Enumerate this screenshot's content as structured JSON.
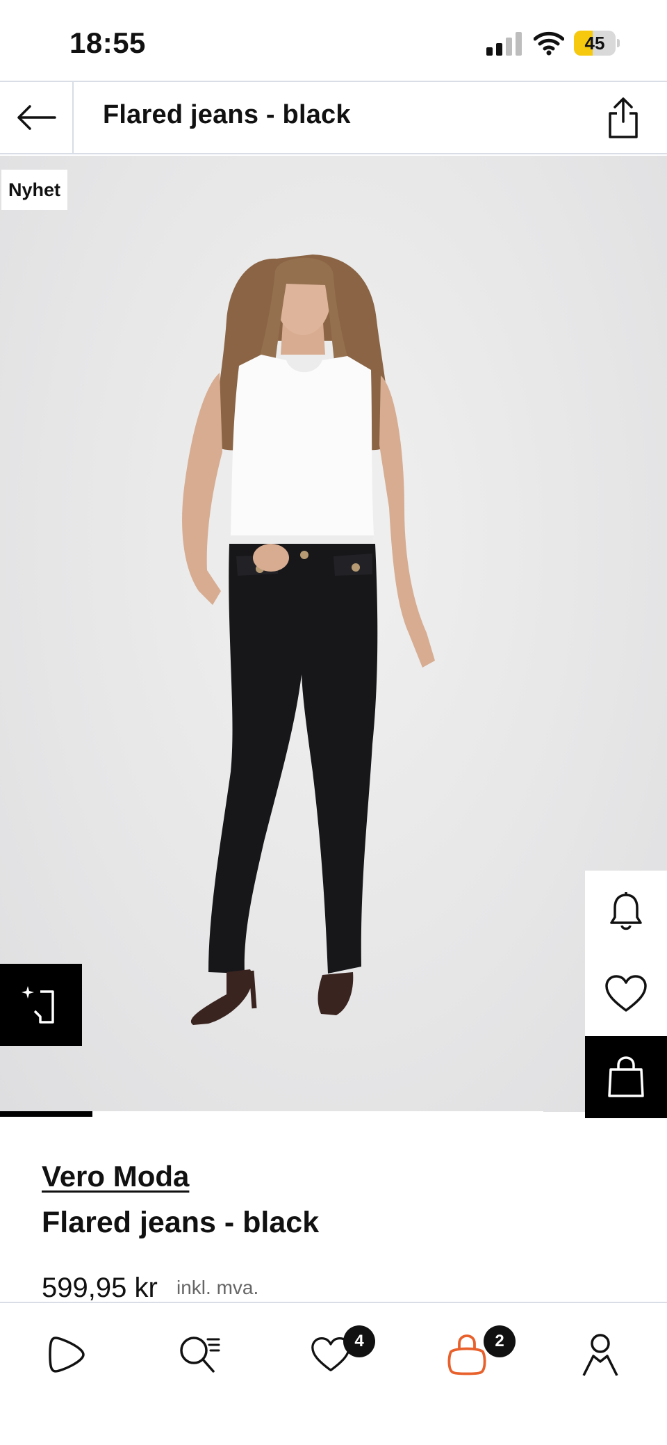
{
  "status_bar": {
    "time": "18:55",
    "battery_level": "45",
    "signal_bars_active": 2,
    "signal_bars_total": 4,
    "battery_color": "#f6c90e"
  },
  "header": {
    "title": "Flared jeans - black",
    "back_icon": "arrow-left-icon",
    "share_icon": "share-icon"
  },
  "product_image": {
    "badge": "Nyhet",
    "carousel_position": 0.17,
    "actions": {
      "notify_icon": "bell-icon",
      "favorite_icon": "heart-icon",
      "add_to_bag_icon": "shopping-bag-icon",
      "size_guide_icon": "size-measure-icon"
    }
  },
  "product": {
    "brand": "Vero Moda",
    "name": "Flared jeans - black",
    "price": "599,95 kr",
    "vat_note": "inkl. mva."
  },
  "bottom_nav": {
    "items": [
      {
        "name": "home",
        "icon": "play-logo-icon"
      },
      {
        "name": "search",
        "icon": "search-list-icon"
      },
      {
        "name": "favorites",
        "icon": "heart-icon",
        "badge": "4"
      },
      {
        "name": "bag",
        "icon": "bag-icon",
        "badge": "2",
        "active": true
      },
      {
        "name": "profile",
        "icon": "user-icon"
      }
    ],
    "active_color": "#e8612c"
  }
}
